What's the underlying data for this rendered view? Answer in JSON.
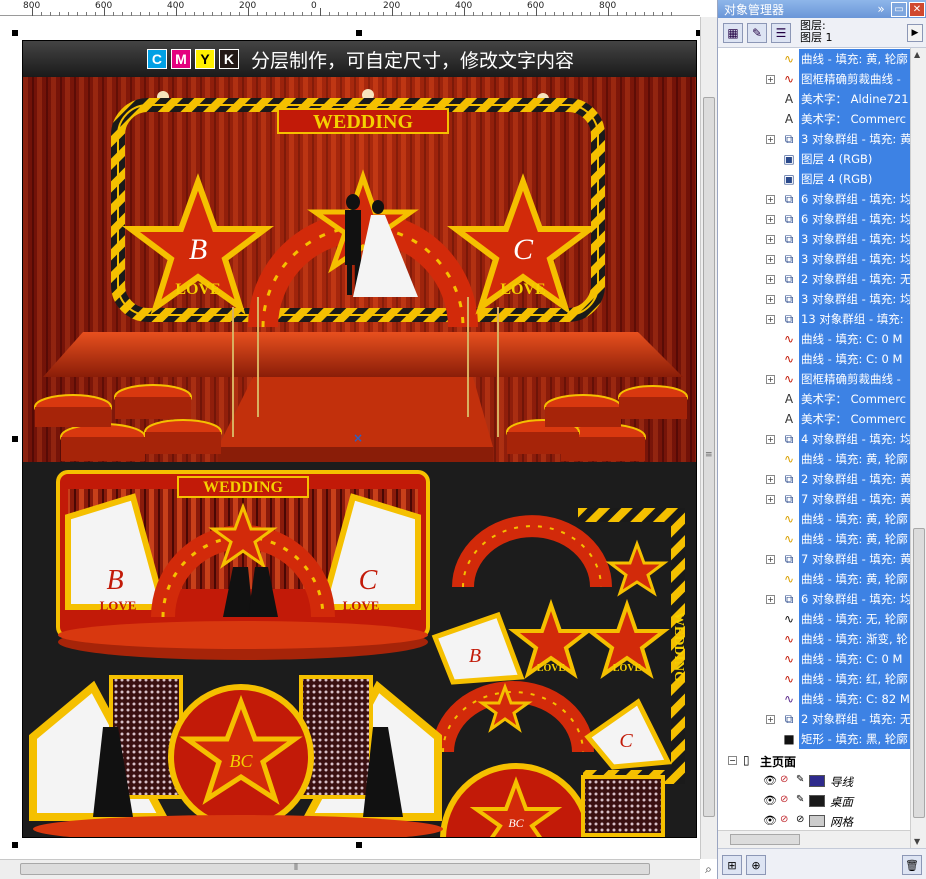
{
  "ruler": {
    "labels": [
      "800",
      "600",
      "400",
      "200",
      "0",
      "200",
      "400",
      "600",
      "800"
    ]
  },
  "banner": {
    "cmyk": [
      "C",
      "M",
      "Y",
      "K"
    ],
    "text": "分层制作，可自定尺寸，修改文字内容"
  },
  "colors": {
    "cyan": "#00a0e4",
    "magenta": "#e4007f",
    "yellow": "#fff000",
    "black": "#231815",
    "selection": "#3d82e4",
    "panel_title": "#6a96d8"
  },
  "design": {
    "sign_main": "WEDDING",
    "sign_second": "WEDDING",
    "sign_vertical": "WEDDING",
    "star_letter_b": "B",
    "star_letter_c": "C",
    "love": "LOVE",
    "bc": "BC"
  },
  "panel": {
    "title": "对象管理器",
    "layer_label": "图层:",
    "layer_name": "图层 1",
    "rows": [
      {
        "icon": "curve-icon",
        "text": "曲线 - 填充: 黄, 轮廓",
        "sel": true,
        "exp": false
      },
      {
        "icon": "powerclip-curve-icon",
        "text": "图框精确剪裁曲线 -",
        "sel": true,
        "exp": true
      },
      {
        "icon": "artistic-text-icon",
        "text": "美术字： Aldine721",
        "sel": true,
        "exp": false
      },
      {
        "icon": "artistic-text-icon",
        "text": "美术字： Commerc",
        "sel": true,
        "exp": false
      },
      {
        "icon": "group-icon",
        "text": "3 对象群组 - 填充: 黄",
        "sel": true,
        "exp": true
      },
      {
        "icon": "bitmap-icon",
        "text": "图层 4 (RGB)",
        "sel": true,
        "exp": false
      },
      {
        "icon": "bitmap-icon",
        "text": "图层 4 (RGB)",
        "sel": true,
        "exp": false
      },
      {
        "icon": "group-icon",
        "text": "6 对象群组 - 填充: 均",
        "sel": true,
        "exp": true
      },
      {
        "icon": "group-icon",
        "text": "6 对象群组 - 填充: 均",
        "sel": true,
        "exp": true
      },
      {
        "icon": "group-icon",
        "text": "3 对象群组 - 填充: 均",
        "sel": true,
        "exp": true
      },
      {
        "icon": "group-icon",
        "text": "3 对象群组 - 填充: 均",
        "sel": true,
        "exp": true
      },
      {
        "icon": "group-icon",
        "text": "2 对象群组 - 填充: 无",
        "sel": true,
        "exp": true
      },
      {
        "icon": "group-icon",
        "text": "3 对象群组 - 填充: 均",
        "sel": true,
        "exp": true
      },
      {
        "icon": "group-icon",
        "text": "13 对象群组 - 填充:",
        "sel": true,
        "exp": true
      },
      {
        "icon": "curve-red-icon",
        "text": "曲线 - 填充: C: 0 M",
        "sel": true,
        "exp": false
      },
      {
        "icon": "curve-red-icon",
        "text": "曲线 - 填充: C: 0 M",
        "sel": true,
        "exp": false
      },
      {
        "icon": "powerclip-curve-icon",
        "text": "图框精确剪裁曲线 -",
        "sel": true,
        "exp": true
      },
      {
        "icon": "artistic-text-icon",
        "text": "美术字： Commerc",
        "sel": true,
        "exp": false
      },
      {
        "icon": "artistic-text-icon",
        "text": "美术字： Commerc",
        "sel": true,
        "exp": false
      },
      {
        "icon": "group-icon",
        "text": "4 对象群组 - 填充: 均",
        "sel": true,
        "exp": true
      },
      {
        "icon": "curve-icon",
        "text": "曲线 - 填充: 黄, 轮廓",
        "sel": true,
        "exp": false
      },
      {
        "icon": "group-icon",
        "text": "2 对象群组 - 填充: 黄",
        "sel": true,
        "exp": true
      },
      {
        "icon": "group-icon",
        "text": "7 对象群组 - 填充: 黄",
        "sel": true,
        "exp": true
      },
      {
        "icon": "curve-icon",
        "text": "曲线 - 填充: 黄, 轮廓",
        "sel": true,
        "exp": false
      },
      {
        "icon": "curve-icon",
        "text": "曲线 - 填充: 黄, 轮廓",
        "sel": true,
        "exp": false
      },
      {
        "icon": "group-icon",
        "text": "7 对象群组 - 填充: 黄",
        "sel": true,
        "exp": true
      },
      {
        "icon": "curve-icon",
        "text": "曲线 - 填充: 黄, 轮廓",
        "sel": true,
        "exp": false
      },
      {
        "icon": "group-icon",
        "text": "6 对象群组 - 填充: 均",
        "sel": true,
        "exp": true
      },
      {
        "icon": "curve-black-icon",
        "text": "曲线 - 填充: 无, 轮廓",
        "sel": true,
        "exp": false
      },
      {
        "icon": "curve-red-icon",
        "text": "曲线 - 填充: 渐变, 轮",
        "sel": true,
        "exp": false
      },
      {
        "icon": "curve-red-icon",
        "text": "曲线 - 填充: C: 0 M",
        "sel": true,
        "exp": false
      },
      {
        "icon": "curve-red-icon",
        "text": "曲线 - 填充: 红, 轮廓",
        "sel": true,
        "exp": false
      },
      {
        "icon": "curve-purple-icon",
        "text": "曲线 - 填充: C: 82 M",
        "sel": true,
        "exp": false
      },
      {
        "icon": "group-icon",
        "text": "2 对象群组 - 填充: 无",
        "sel": true,
        "exp": true
      },
      {
        "icon": "rectangle-icon",
        "text": "矩形 - 填充: 黑, 轮廓",
        "sel": true,
        "exp": false
      }
    ],
    "master_page": "主页面",
    "master_layers": [
      {
        "name": "导线",
        "swatch": "#2e2a8c"
      },
      {
        "name": "桌面",
        "swatch": "#1a1a1a"
      },
      {
        "name": "网格",
        "swatch": "#cccccc"
      }
    ]
  }
}
